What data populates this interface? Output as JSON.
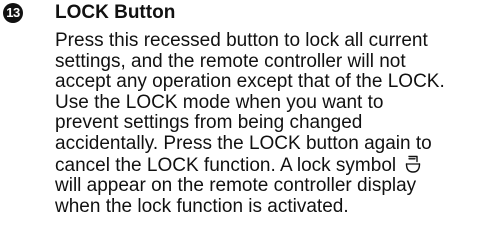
{
  "section": {
    "number": "13",
    "heading": "LOCK Button",
    "lines": [
      "Press this recessed button to lock all current",
      "settings, and the remote controller will not",
      "accept any operation except that of the LOCK.",
      "Use the LOCK mode when you want to",
      "prevent settings from being changed",
      "accidentally. Press the LOCK button again to",
      "cancel the LOCK function. A lock symbol",
      "will appear on the remote controller display",
      "when the lock function is activated."
    ],
    "inline_icon": "lock-symbol-icon"
  }
}
